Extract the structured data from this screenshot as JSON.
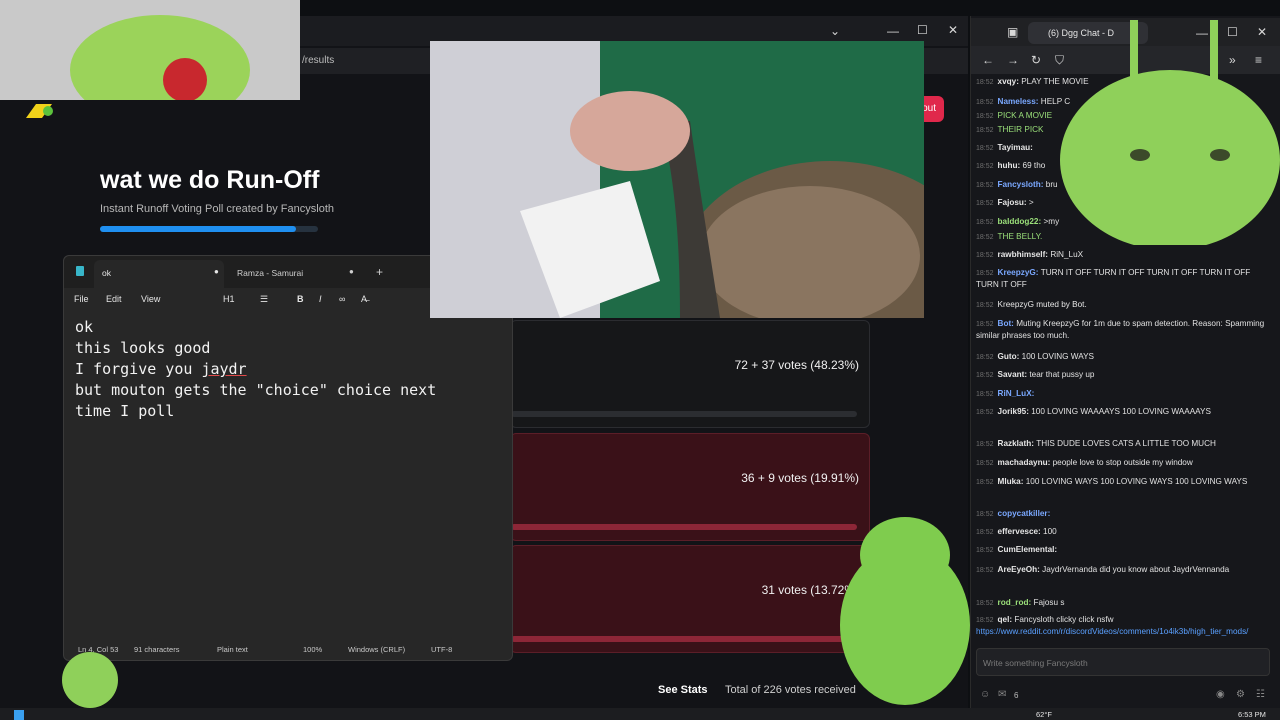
{
  "browser_left": {
    "url_fragment": "/results",
    "logout_label": "out"
  },
  "poll": {
    "title": "wat we do Run-Off",
    "subtitle": "Instant Runoff Voting Poll created by Fancysloth",
    "progress": 0.9,
    "results": [
      {
        "votes": "72 + 37 votes (48.23%)"
      },
      {
        "votes": "36 + 9 votes (19.91%)"
      },
      {
        "votes": "31 votes (13.72%)"
      }
    ],
    "see_stats": "See Stats",
    "total": "Total of 226 votes received"
  },
  "notepad": {
    "tabs": [
      {
        "label": "ok"
      },
      {
        "label": "Ramza - Samurai"
      }
    ],
    "menu": {
      "file": "File",
      "edit": "Edit",
      "view": "View",
      "heading": "H1"
    },
    "text_lines": [
      "ok",
      "this looks good",
      "I forgive you ",
      "jaydr",
      "but mouton gets the \"choice\" choice next",
      "time I poll"
    ],
    "status": {
      "position": "Ln 4, Col 53",
      "chars": "91 characters",
      "format": "Plain text",
      "zoom": "100%",
      "line_ending": "Windows (CRLF)",
      "encoding": "UTF-8"
    }
  },
  "chat": {
    "tab_title": "(6) Dgg Chat - D",
    "input_placeholder": "Write something Fancysloth",
    "viewer_count": "6",
    "messages": [
      {
        "user": "xvqy",
        "text": "PLAY THE MOVIE",
        "user_color": "#e6e6e6"
      },
      {
        "user": "Nameless",
        "text": "HELP C",
        "user_color": "#7aa8ff"
      },
      {
        "user": "",
        "text": "PICK A MOVIE",
        "user_color": "#9be07a"
      },
      {
        "user": "",
        "text": "THEIR PICK",
        "user_color": "#9be07a"
      },
      {
        "user": "Tayimau",
        "text": "",
        "user_color": "#e6e6e6"
      },
      {
        "user": "huhu",
        "text": "69 tho",
        "user_color": "#e6e6e6"
      },
      {
        "user": "Fancysloth",
        "text": "bru",
        "user_color": "#7aa8ff"
      },
      {
        "user": "Fajosu",
        "text": ">",
        "user_color": "#e6e6e6"
      },
      {
        "user": "balddog22",
        "text": ">my",
        "user_color": "#9be07a"
      },
      {
        "user": "",
        "text": "THE BELLY.",
        "user_color": "#9be07a"
      },
      {
        "user": "rawbhimself",
        "text": "RiN_LuX",
        "user_color": "#e6e6e6"
      },
      {
        "user": "KreepzyG",
        "text": "TURN IT OFF  TURN IT OFF  TURN IT OFF  TURN IT OFF  TURN IT OFF",
        "user_color": "#7aa8ff"
      },
      {
        "user": "",
        "text": "KreepzyG muted by Bot.",
        "user_color": "#e6e6e6"
      },
      {
        "user": "Bot",
        "text": "Muting KreepzyG for 1m due to spam detection. Reason: Spamming similar phrases too much.",
        "user_color": "#7aa8ff"
      },
      {
        "user": "Guto",
        "text": "100 LOVING WAYS",
        "user_color": "#e6e6e6"
      },
      {
        "user": "Savant",
        "text": "tear that pussy up",
        "user_color": "#e6e6e6"
      },
      {
        "user": "RiN_LuX",
        "text": "",
        "user_color": "#7aa8ff"
      },
      {
        "user": "Jorik95",
        "text": "100 LOVING WAAAAYS  100 LOVING WAAAAYS",
        "user_color": "#e6e6e6"
      },
      {
        "user": "Razklath",
        "text": "THIS DUDE LOVES CATS A LITTLE TOO MUCH",
        "user_color": "#e6e6e6"
      },
      {
        "user": "machadaynu",
        "text": "people love to stop outside my window",
        "user_color": "#e6e6e6"
      },
      {
        "user": "Mluka",
        "text": "100 LOVING WAYS  100 LOVING WAYS  100 LOVING WAYS",
        "user_color": "#e6e6e6"
      },
      {
        "user": "copycatkiller",
        "text": "",
        "user_color": "#7aa8ff"
      },
      {
        "user": "effervesce",
        "text": "100",
        "user_color": "#e6e6e6"
      },
      {
        "user": "CumElemental",
        "text": "",
        "user_color": "#e6e6e6"
      },
      {
        "user": "AreEyeOh",
        "text": "JaydrVernanda did you know about JaydrVennanda",
        "user_color": "#e6e6e6"
      },
      {
        "user": "rod_rod",
        "text": "Fajosu s",
        "user_color": "#9be07a"
      },
      {
        "user": "qel",
        "text": "Fancysloth clicky click nsfw ",
        "link": "https://www.reddit.com/r/discordVideos/comments/1o4ik3b/high_tier_mods/",
        "user_color": "#e6e6e6"
      }
    ],
    "timestamp": "18:52"
  },
  "taskbar": {
    "weather": "62°F",
    "time": "6:53 PM"
  }
}
